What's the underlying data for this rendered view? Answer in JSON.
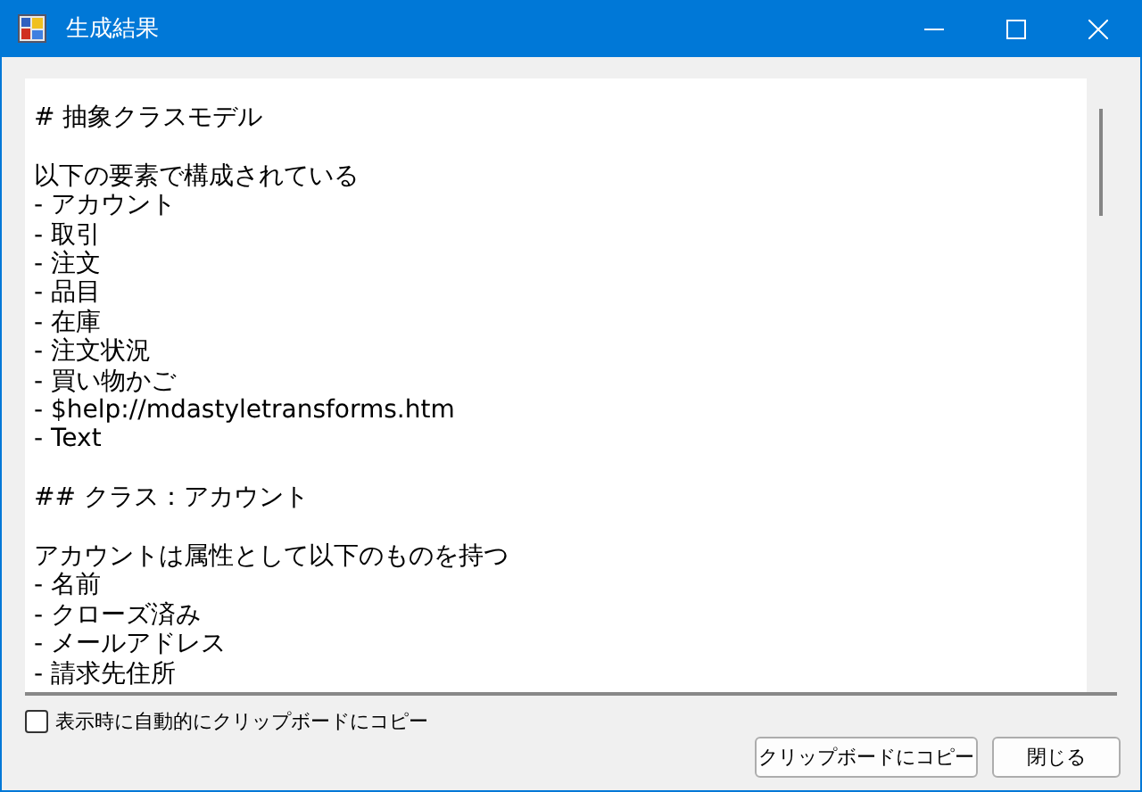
{
  "window": {
    "title": "生成結果"
  },
  "text_area": {
    "blocks": [
      [
        "# 抽象クラスモデル"
      ],
      [
        "以下の要素で構成されている",
        "- アカウント",
        "- 取引",
        "- 注文",
        "- 品目",
        "- 在庫",
        "- 注文状況",
        "- 買い物かご",
        "- $help://mdastyletransforms.htm",
        "- Text"
      ],
      [
        "## クラス：アカウント"
      ],
      [
        "アカウントは属性として以下のものを持つ",
        "- 名前",
        "- クローズ済み",
        "- メールアドレス",
        "- 請求先住所"
      ]
    ]
  },
  "auto_copy": {
    "label": "表示時に自動的にクリップボードにコピー",
    "checked": false
  },
  "buttons": [
    "クリップボードにコピー",
    "閉じる"
  ]
}
